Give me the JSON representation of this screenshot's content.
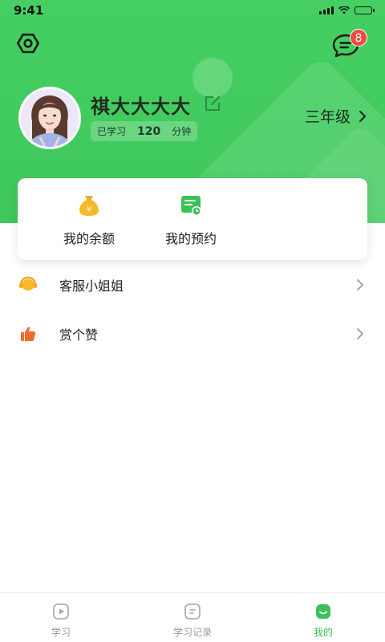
{
  "status_bar": {
    "time": "9:41"
  },
  "header": {
    "message_badge_count": "8",
    "username": "祺大大大大",
    "study": {
      "prefix": "已学习",
      "minutes": "120",
      "unit": "分钟"
    },
    "grade": "三年级"
  },
  "card": {
    "items": [
      {
        "label": "我的余额",
        "icon": "money-bag-icon"
      },
      {
        "label": "我的预约",
        "icon": "appointment-icon"
      }
    ]
  },
  "list": {
    "items": [
      {
        "label": "客服小姐姐",
        "icon": "customer-service-icon"
      },
      {
        "label": "赏个赞",
        "icon": "thumbs-up-icon"
      }
    ]
  },
  "tabbar": {
    "tabs": [
      {
        "label": "学习",
        "icon": "play-icon",
        "active": false
      },
      {
        "label": "学习记录",
        "icon": "record-icon",
        "active": false
      },
      {
        "label": "我的",
        "icon": "mine-icon",
        "active": true
      }
    ]
  },
  "colors": {
    "brand_green": "#45cf62",
    "badge_red": "#f24a3c",
    "active_tab": "#3cc15a",
    "inactive_tab": "#999999"
  }
}
